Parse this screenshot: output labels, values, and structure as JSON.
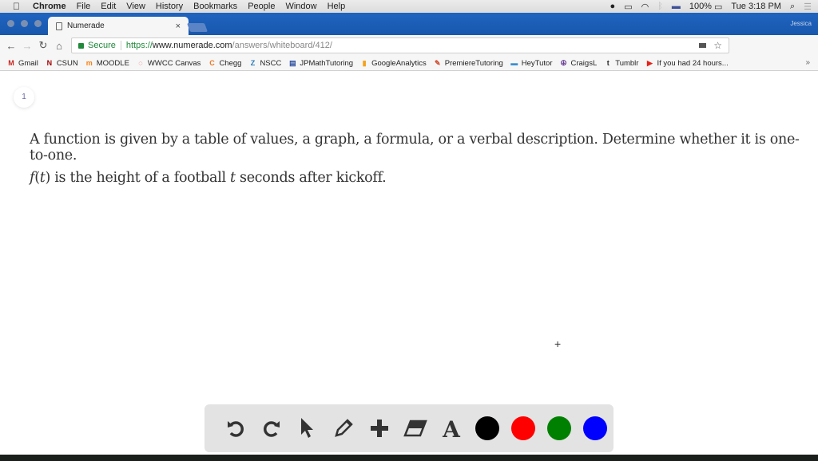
{
  "menubar": {
    "app_name": "Chrome",
    "items": [
      "File",
      "Edit",
      "View",
      "History",
      "Bookmarks",
      "People",
      "Window",
      "Help"
    ],
    "battery": "100%",
    "clock": "Tue 3:18 PM"
  },
  "browser": {
    "tab_title": "Numerade",
    "tab_close": "×",
    "profile_name": "Jessica",
    "url_scheme": "https://",
    "url_host": "www.numerade.com",
    "url_path": "/answers/whiteboard/412/",
    "secure_label": "Secure",
    "overflow_label": "»",
    "bookmarks": [
      {
        "label": "Gmail",
        "icon": "gmail-icon",
        "glyph": "M",
        "color": "#c5221f"
      },
      {
        "label": "CSUN",
        "icon": "csun-icon",
        "glyph": "N",
        "color": "#a00000"
      },
      {
        "label": "MOODLE",
        "icon": "moodle-icon",
        "glyph": "m",
        "color": "#f98012"
      },
      {
        "label": "WWCC Canvas",
        "icon": "canvas-icon",
        "glyph": "◌",
        "color": "#e02d2d"
      },
      {
        "label": "Chegg",
        "icon": "chegg-icon",
        "glyph": "C",
        "color": "#e87722"
      },
      {
        "label": "NSCC",
        "icon": "nscc-icon",
        "glyph": "Z",
        "color": "#2a7ab8"
      },
      {
        "label": "JPMathTutoring",
        "icon": "calendar-icon",
        "glyph": "▤",
        "color": "#2c4fa0"
      },
      {
        "label": "GoogleAnalytics",
        "icon": "analytics-icon",
        "glyph": "▮",
        "color": "#f4a21a"
      },
      {
        "label": "PremiereTutoring",
        "icon": "premiere-icon",
        "glyph": "✎",
        "color": "#d04a2a"
      },
      {
        "label": "HeyTutor",
        "icon": "heytutor-icon",
        "glyph": "▬",
        "color": "#3a8fd0"
      },
      {
        "label": "CraigsL",
        "icon": "peace-icon",
        "glyph": "☮",
        "color": "#5a2d8a"
      },
      {
        "label": "Tumblr",
        "icon": "tumblr-icon",
        "glyph": "t",
        "color": "#222"
      },
      {
        "label": "If you had 24 hours...",
        "icon": "youtube-icon",
        "glyph": "▶",
        "color": "#e62117"
      }
    ]
  },
  "page": {
    "page_number": "1",
    "question_line1": "A function is given by a table of values, a graph, a formula, or a verbal description. Determine whether it is one-to-one.",
    "question_fn": "f",
    "question_var": "t",
    "question_line2_a": ") is the height of a football ",
    "question_line2_b": " seconds after kickoff.",
    "crosshair": "+"
  },
  "whiteboard_tools": {
    "tools": [
      "undo",
      "redo",
      "select",
      "pen",
      "add",
      "eraser",
      "text"
    ],
    "colors": [
      "#000000",
      "#ff0000",
      "#008000",
      "#0000ff"
    ]
  }
}
